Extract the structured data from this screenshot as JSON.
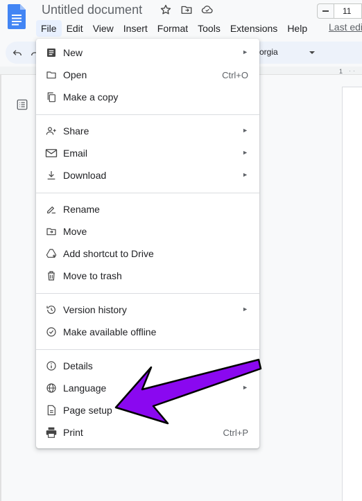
{
  "document": {
    "title": "Untitled document"
  },
  "menubar": {
    "items": [
      "File",
      "Edit",
      "View",
      "Insert",
      "Format",
      "Tools",
      "Extensions",
      "Help"
    ],
    "last_edit": "Last edi"
  },
  "toolbar": {
    "font_name": "orgia",
    "font_size": "11"
  },
  "ruler": {
    "mark": "1"
  },
  "file_menu": {
    "new": "New",
    "open": "Open",
    "open_shortcut": "Ctrl+O",
    "make_copy": "Make a copy",
    "share": "Share",
    "email": "Email",
    "download": "Download",
    "rename": "Rename",
    "move": "Move",
    "add_shortcut": "Add shortcut to Drive",
    "move_to_trash": "Move to trash",
    "version_history": "Version history",
    "make_available_offline": "Make available offline",
    "details": "Details",
    "language": "Language",
    "page_setup": "Page setup",
    "print": "Print",
    "print_shortcut": "Ctrl+P"
  },
  "colors": {
    "annotation_arrow": "#8a08f0",
    "menu_active_bg": "#e8f0fe",
    "docs_blue": "#4285f4"
  }
}
